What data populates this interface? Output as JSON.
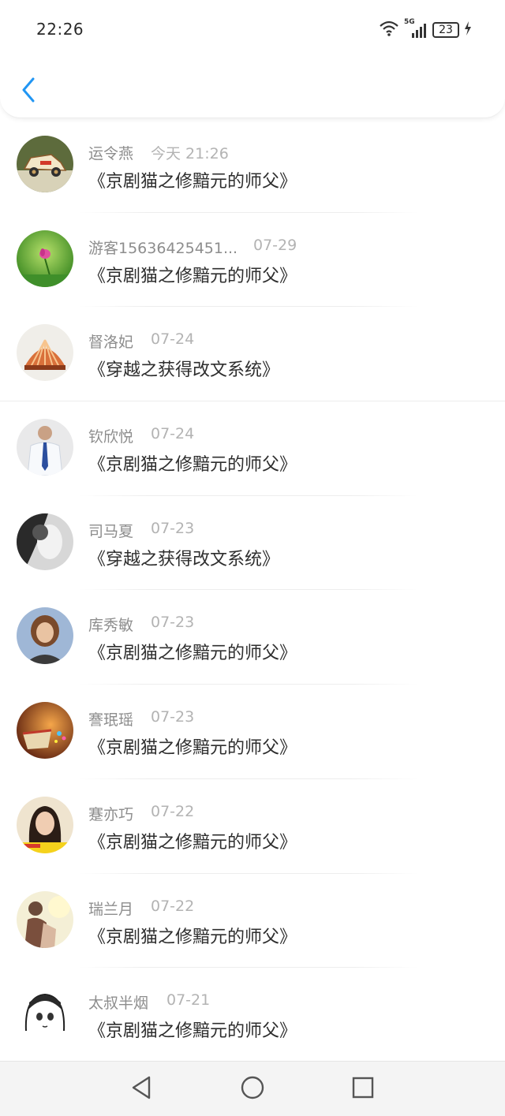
{
  "status_bar": {
    "time": "22:26",
    "network": "5G",
    "battery": "23",
    "icons": [
      "wifi-icon",
      "signal-icon",
      "battery-icon",
      "charging-icon"
    ]
  },
  "header": {
    "back_icon": "chevron-left-icon",
    "accent_color": "#2196F3"
  },
  "list": [
    {
      "name": "运令燕",
      "date": "今天 21:26",
      "title": "《京剧猫之修黯元的师父》",
      "avatar": "toy-car-avatar"
    },
    {
      "name": "游客15636425451...",
      "date": "07-29",
      "title": "《京剧猫之修黯元的师父》",
      "avatar": "flower-avatar"
    },
    {
      "name": "督洛妃",
      "date": "07-24",
      "title": "《穿越之获得改文系统》",
      "avatar": "shell-avatar"
    },
    {
      "name": "钦欣悦",
      "date": "07-24",
      "title": "《京剧猫之修黯元的师父》",
      "avatar": "man-tie-avatar"
    },
    {
      "name": "司马夏",
      "date": "07-23",
      "title": "《穿越之获得改文系统》",
      "avatar": "bw-couple-avatar"
    },
    {
      "name": "库秀敏",
      "date": "07-23",
      "title": "《京剧猫之修黯元的师父》",
      "avatar": "woman-avatar"
    },
    {
      "name": "謇珉瑶",
      "date": "07-23",
      "title": "《京剧猫之修黯元的师父》",
      "avatar": "cup-avatar"
    },
    {
      "name": "蹇亦巧",
      "date": "07-22",
      "title": "《京剧猫之修黯元的师父》",
      "avatar": "girl-avatar"
    },
    {
      "name": "瑞兰月",
      "date": "07-22",
      "title": "《京剧猫之修黯元的师父》",
      "avatar": "couple-avatar"
    },
    {
      "name": "太叔半烟",
      "date": "07-21",
      "title": "《京剧猫之修黯元的师父》",
      "avatar": "anime-girl-avatar"
    }
  ],
  "navbar": {
    "icons": [
      "back-triangle-icon",
      "home-circle-icon",
      "recents-square-icon"
    ]
  }
}
